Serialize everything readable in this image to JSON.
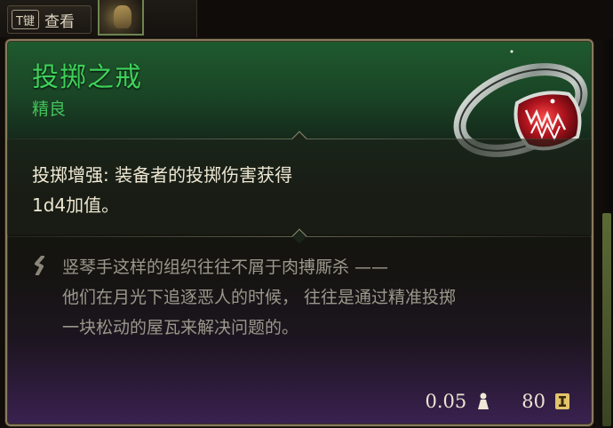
{
  "hint": {
    "key": "T键",
    "label": "查看"
  },
  "item": {
    "name": "投掷之戒",
    "rarity": "精良",
    "effect_name": "投掷增强:",
    "effect_line1": "装备者的投掷伤害获得",
    "effect_line2": "1d4加值。",
    "flavor_line1": "竖琴手这样的组织往往不屑于肉搏厮杀 ——",
    "flavor_line2": "他们在月光下追逐恶人的时候， 往往是通过精准投掷",
    "flavor_line3": "一块松动的屋瓦来解决问题的。",
    "weight": "0.05",
    "value": "80"
  },
  "colors": {
    "name": "#3ed15a",
    "rarity": "#44c25b",
    "border": "#8a7b5e",
    "gem": "#b0141e"
  },
  "icons": {
    "hint_thumb": "character-portrait-thumb",
    "ring": "ring-item-icon",
    "flavor": "quote-mark-icon",
    "weight": "weight-icon",
    "value": "gold-coin-icon"
  }
}
